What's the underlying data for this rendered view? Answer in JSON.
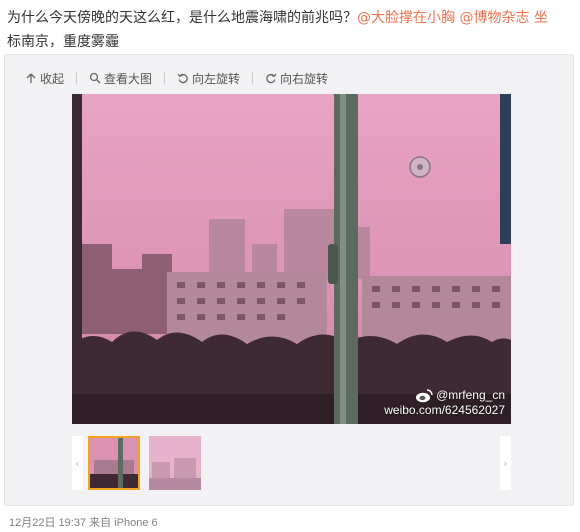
{
  "post": {
    "text_main": "为什么今天傍晚的天这么红，是什么地震海啸的前兆吗？",
    "mention_1": "@大脸撑在小胸",
    "mention_2": "@博物杂志",
    "text_tail_1": "坐",
    "text_tail_2": "标南京，重度雾霾"
  },
  "toolbar": {
    "collapse_label": "收起",
    "view_large_label": "查看大图",
    "rotate_left_label": "向左旋转",
    "rotate_right_label": "向右旋转"
  },
  "photo": {
    "watermark_handle": "@mrfeng_cn",
    "watermark_url": "weibo.com/624562027"
  },
  "thumbnails": {
    "prev_arrow": "‹",
    "next_arrow": "›"
  },
  "meta": {
    "timestamp": "12月22日 19:37",
    "source": "来自 iPhone 6"
  },
  "colors": {
    "mention": "#eb7350",
    "active_thumb_border": "#f5a223",
    "sky_pink": "#e39ab9"
  }
}
